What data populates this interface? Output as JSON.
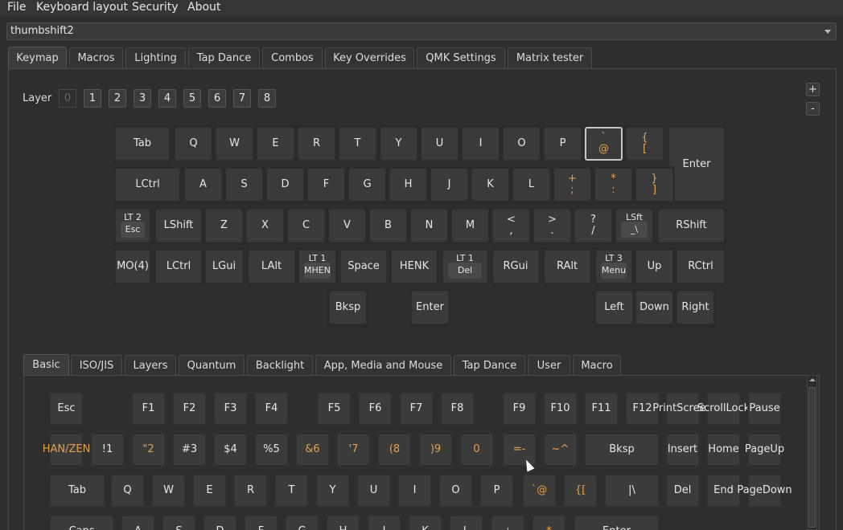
{
  "menubar": {
    "items": [
      "File",
      "Keyboard layout",
      "Security",
      "About"
    ]
  },
  "keyboard_select": {
    "value": "thumbshift2"
  },
  "main_tabs": [
    "Keymap",
    "Macros",
    "Lighting",
    "Tap Dance",
    "Combos",
    "Key Overrides",
    "QMK Settings",
    "Matrix tester"
  ],
  "layers": {
    "label": "Layer",
    "buttons": [
      "0",
      "1",
      "2",
      "3",
      "4",
      "5",
      "6",
      "7",
      "8"
    ],
    "active": "0"
  },
  "side_buttons": {
    "add": "+",
    "remove": "-"
  },
  "keymap": {
    "row1": [
      "Tab",
      "Q",
      "W",
      "E",
      "R",
      "T",
      "Y",
      "U",
      "I",
      "O",
      "P"
    ],
    "row1_sel": {
      "top": "`",
      "bottom": "@"
    },
    "row1_brace": {
      "top": "{",
      "bottom": "["
    },
    "enter": "Enter",
    "row2": [
      "LCtrl",
      "A",
      "S",
      "D",
      "F",
      "G",
      "H",
      "J",
      "K",
      "L"
    ],
    "row2_sym": [
      {
        "top": "+",
        "bottom": ";"
      },
      {
        "top": "*",
        "bottom": ":"
      },
      {
        "top": "}",
        "bottom": "]"
      }
    ],
    "row3_lt2": {
      "top": "LT 2",
      "inner": "Esc"
    },
    "row3": [
      "LShift",
      "Z",
      "X",
      "C",
      "V",
      "B",
      "N",
      "M"
    ],
    "row3_sym": [
      {
        "top": "<",
        "bottom": ","
      },
      {
        "top": ">",
        "bottom": "."
      },
      {
        "top": "?",
        "bottom": "/"
      }
    ],
    "row3_lsft": {
      "top": "LSft",
      "inner": "_\\"
    },
    "row3_rshift": "RShift",
    "row4": [
      "MO(4)",
      "LCtrl",
      "LGui",
      "LAlt"
    ],
    "row4_lt1a": {
      "top": "LT 1",
      "inner": "MHEN"
    },
    "row4_mid": [
      "Space",
      "HENK"
    ],
    "row4_lt1b": {
      "top": "LT 1",
      "inner": "Del"
    },
    "row4_right": [
      "RGui",
      "RAlt"
    ],
    "row4_lt3": {
      "top": "LT 3",
      "inner": "Menu"
    },
    "row4_end": [
      "Up",
      "RCtrl"
    ],
    "row5": [
      "Bksp",
      "Enter",
      "Left",
      "Down",
      "Right"
    ]
  },
  "basic_tabs": [
    "Basic",
    "ISO/JIS",
    "Layers",
    "Quantum",
    "Backlight",
    "App, Media and Mouse",
    "Tap Dance",
    "User",
    "Macro"
  ],
  "basic": {
    "fn_row": [
      "Esc",
      "F1",
      "F2",
      "F3",
      "F4",
      "F5",
      "F6",
      "F7",
      "F8",
      "F9",
      "F10",
      "F11",
      "F12",
      "Print Screen",
      "Scroll Lock",
      "Pause"
    ],
    "num_row": [
      {
        "t": "HAN/",
        "b": "ZEN",
        "o": true
      },
      {
        "t": "!",
        "b": "1"
      },
      {
        "t": "\"",
        "b": "2",
        "o": true
      },
      {
        "t": "#",
        "b": "3"
      },
      {
        "t": "$",
        "b": "4"
      },
      {
        "t": "%",
        "b": "5"
      },
      {
        "t": "&",
        "b": "6",
        "o": true
      },
      {
        "t": "'",
        "b": "7",
        "o": true
      },
      {
        "t": "(",
        "b": "8",
        "o": true
      },
      {
        "t": ")",
        "b": "9",
        "o": true
      },
      {
        "t": "",
        "b": "0",
        "o": true
      },
      {
        "t": "=",
        "b": "-",
        "o": true
      },
      {
        "t": "~",
        "b": "^",
        "o": true
      }
    ],
    "num_row_end": [
      "Bksp",
      "Insert",
      "Home",
      "Page Up"
    ],
    "q_row": [
      "Tab",
      "Q",
      "W",
      "E",
      "R",
      "T",
      "Y",
      "U",
      "I",
      "O",
      "P"
    ],
    "q_row_sym": [
      {
        "t": "`",
        "b": "@"
      },
      {
        "t": "{",
        "b": "["
      },
      {
        "t": "|",
        "b": "\\"
      }
    ],
    "q_row_end": [
      "Del",
      "End",
      "Page Down"
    ],
    "a_row": [
      "Caps",
      "A",
      "S",
      "D",
      "F",
      "G",
      "H",
      "J",
      "K",
      "L"
    ],
    "a_row_sym": [
      {
        "t": "+",
        "b": ""
      },
      {
        "t": "*",
        "b": ""
      }
    ],
    "a_row_enter": "Enter"
  }
}
